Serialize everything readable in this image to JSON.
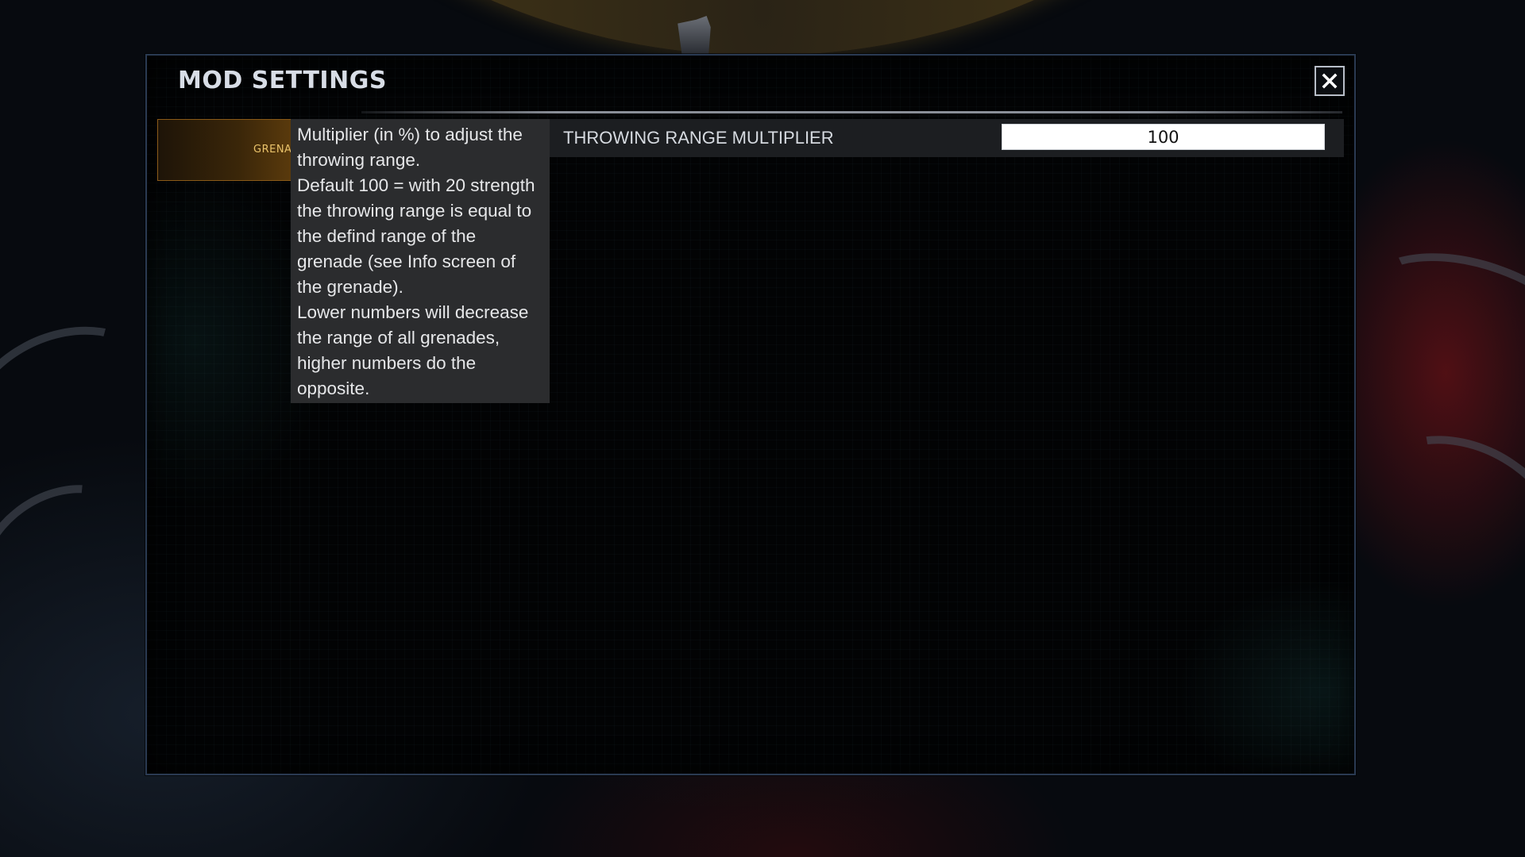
{
  "modal": {
    "title": "MOD SETTINGS"
  },
  "close_icon": "close-x-icon",
  "category_tab": {
    "label": "GRENA"
  },
  "tooltip": {
    "lines": [
      "Multiplier (in %) to adjust the",
      "throwing range.",
      "Default 100 = with 20 strength",
      "the throwing range is equal to",
      "the defind range of the",
      "grenade (see Info screen of",
      "the grenade).",
      "Lower numbers will decrease",
      "the range of all grenades,",
      "higher numbers do the",
      "opposite."
    ]
  },
  "setting": {
    "label": "THROWING RANGE MULTIPLIER",
    "value": "100"
  },
  "colors": {
    "accent": "#e9c26a",
    "panel_border": "#2a3a52",
    "tooltip_bg": "#2b2c2e"
  }
}
